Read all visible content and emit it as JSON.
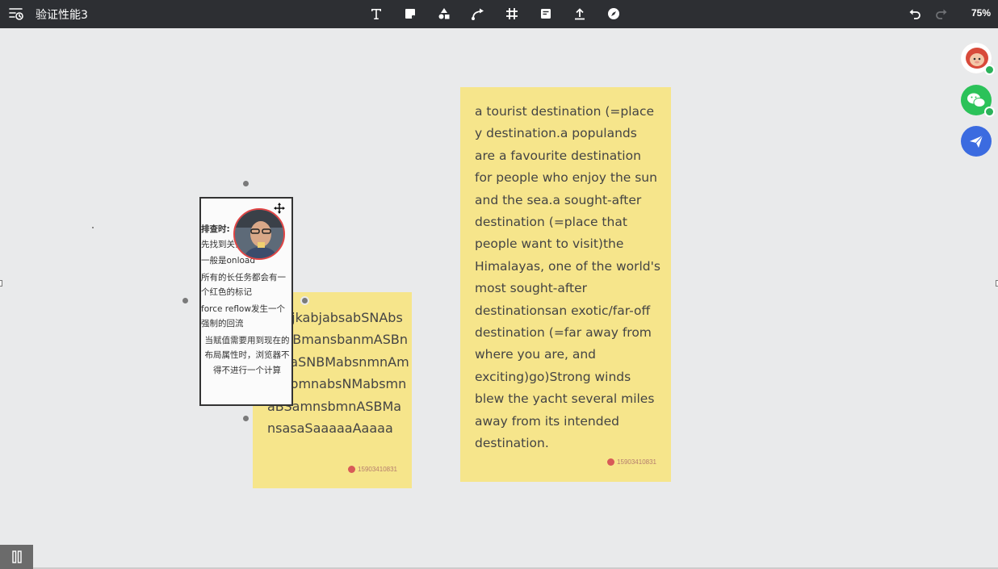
{
  "app": {
    "board_title": "验证性能3",
    "zoom_level": "75%"
  },
  "toolbar": {
    "tools": [
      {
        "name": "text-tool",
        "icon": "text-icon"
      },
      {
        "name": "sticky-note-tool",
        "icon": "sticky-note-icon"
      },
      {
        "name": "shape-tool",
        "icon": "shapes-icon"
      },
      {
        "name": "connector-tool",
        "icon": "connector-icon"
      },
      {
        "name": "frame-tool",
        "icon": "frame-icon"
      },
      {
        "name": "template-tool",
        "icon": "template-icon"
      },
      {
        "name": "upload-tool",
        "icon": "upload-icon"
      },
      {
        "name": "compass-tool",
        "icon": "compass-icon"
      }
    ],
    "undo_icon": "undo-icon",
    "redo_icon": "redo-icon"
  },
  "notes": {
    "note_a": {
      "text": "a tourist destination (=place y destination.a populands are a favourite destination for people who enjoy the sun and the sea.a sought-after destination (=place that people want to visit)the Himalayas, one of the world's most sought-after destinationsan exotic/far-off destination (=far away from where you are, and exciting)go)Strong winds blew the yacht several miles away from its intended destination.",
      "author": "15903410831"
    },
    "note_b": {
      "text": "abdjkabjabsabSNAbsnASBmansbanmASBnasbaSNBMabsnmnAmnasbmnabsNMabsmnaBSamnsbmnASBMansasaSaaaaaAaaaa",
      "author": "15903410831"
    }
  },
  "card": {
    "heading": "排查时:",
    "lines": [
      "先找到关键",
      "一般是onload",
      "所有的长任务都会有一个红色的标记",
      "force reflow发生一个强制的回流"
    ],
    "center_text": "当赋值需要用到现在的布局属性时，浏览器不得不进行一个计算"
  },
  "sidebar": {
    "buttons": [
      {
        "name": "user-avatar-button",
        "icon": "user-avatar"
      },
      {
        "name": "wechat-button",
        "icon": "wechat-icon"
      },
      {
        "name": "share-button",
        "icon": "send-icon"
      }
    ]
  },
  "colors": {
    "toolbar_bg": "#2d2f33",
    "canvas_bg": "#e9eaeb",
    "sticky_yellow": "#f6e58b",
    "wechat_green": "#2bc259",
    "share_blue": "#3b6be0"
  }
}
